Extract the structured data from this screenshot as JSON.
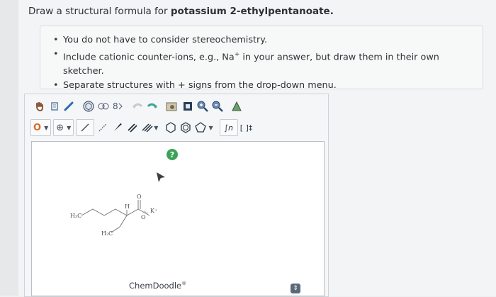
{
  "question": {
    "prefix": "Draw a structural formula for ",
    "compound": "potassium 2-ethylpentanoate."
  },
  "instructions": [
    {
      "text_before": "You do not have to consider stereochemistry.",
      "sup": "",
      "text_after": ""
    },
    {
      "text_before": "Include cationic counter-ions, e.g., Na",
      "sup": "+",
      "text_after": " in your answer, but draw them in their own sketcher."
    },
    {
      "text_before": "Separate structures with + signs from the drop-down menu.",
      "sup": "",
      "text_after": ""
    }
  ],
  "editor": {
    "toolbar_row1": [
      "hand-icon",
      "eraser-icon",
      "lasso-icon",
      "ring-template-icon",
      "ring-template-icon",
      "bond-chain-icon",
      "undo-icon",
      "redo-icon",
      "paste-icon",
      "clear-icon",
      "zoom-in-icon",
      "zoom-out-icon",
      "settings-icon"
    ],
    "toolbar_row2": {
      "atom_label": "O",
      "charge_label": "⊕",
      "func_label": "∫n",
      "bracket_label": "[ ]‡"
    },
    "help_label": "?",
    "brand": "ChemDoodle",
    "brand_mark": "®",
    "molecule_labels": {
      "h3c_top": "H₃C",
      "h3c_bottom": "H₃C",
      "h": "H",
      "o_double": "O",
      "o_single": "O",
      "k": "K⁺"
    }
  },
  "colors": {
    "accent_green": "#3aa357",
    "toolbar_icon": "#4a5560"
  }
}
